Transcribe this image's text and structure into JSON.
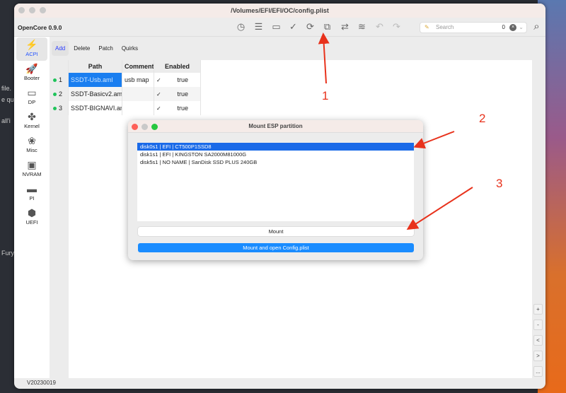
{
  "background": {
    "left_text": [
      "file.",
      "e qua",
      "all'i",
      "Fury"
    ]
  },
  "window": {
    "title": "/Volumes/EFI/EFI/OC/config.plist",
    "app_name": "OpenCore 0.9.0",
    "version": "V20230019"
  },
  "toolbar": {
    "icons": [
      "history-icon",
      "list-icon",
      "save-icon",
      "check-icon",
      "refresh-list-icon",
      "mount-esp-icon",
      "import-icon",
      "database-icon",
      "undo-icon",
      "redo-icon"
    ],
    "search_placeholder": "Search",
    "search_count": "0"
  },
  "sidebar": {
    "items": [
      {
        "label": "ACPI",
        "icon": "⚡"
      },
      {
        "label": "Booter",
        "icon": "🚀"
      },
      {
        "label": "DP",
        "icon": "▭"
      },
      {
        "label": "Kernel",
        "icon": "✤"
      },
      {
        "label": "Misc",
        "icon": "❀"
      },
      {
        "label": "NVRAM",
        "icon": "▣"
      },
      {
        "label": "PI",
        "icon": "▬"
      },
      {
        "label": "UEFI",
        "icon": "⬢"
      }
    ]
  },
  "tabs": [
    "Add",
    "Delete",
    "Patch",
    "Quirks"
  ],
  "table": {
    "headers": [
      "Path",
      "Comment",
      "Enabled"
    ],
    "rows": [
      {
        "index": "1",
        "path": "SSDT-Usb.aml",
        "comment": "usb map",
        "enabled": "true"
      },
      {
        "index": "2",
        "path": "SSDT-Basicv2.aml",
        "comment": "",
        "enabled": "true"
      },
      {
        "index": "3",
        "path": "SSDT-BIGNAVI.aml",
        "comment": "",
        "enabled": "true"
      }
    ]
  },
  "side_buttons": [
    "+",
    "-",
    "<",
    ">",
    "..."
  ],
  "dialog": {
    "title": "Mount ESP partition",
    "partitions": [
      "disk0s1 | EFI | CT500P1SSD8",
      "disk1s1 | EFI | KINGSTON SA2000M81000G",
      "disk5s1 | NO NAME | SanDisk SSD PLUS 240GB"
    ],
    "mount_label": "Mount",
    "mount_open_label": "Mount and open Config.plist"
  },
  "annotations": [
    "1",
    "2",
    "3"
  ],
  "colors": {
    "accent": "#1a8cff",
    "selection": "#1a6ae8",
    "arrow": "#e8321c"
  }
}
